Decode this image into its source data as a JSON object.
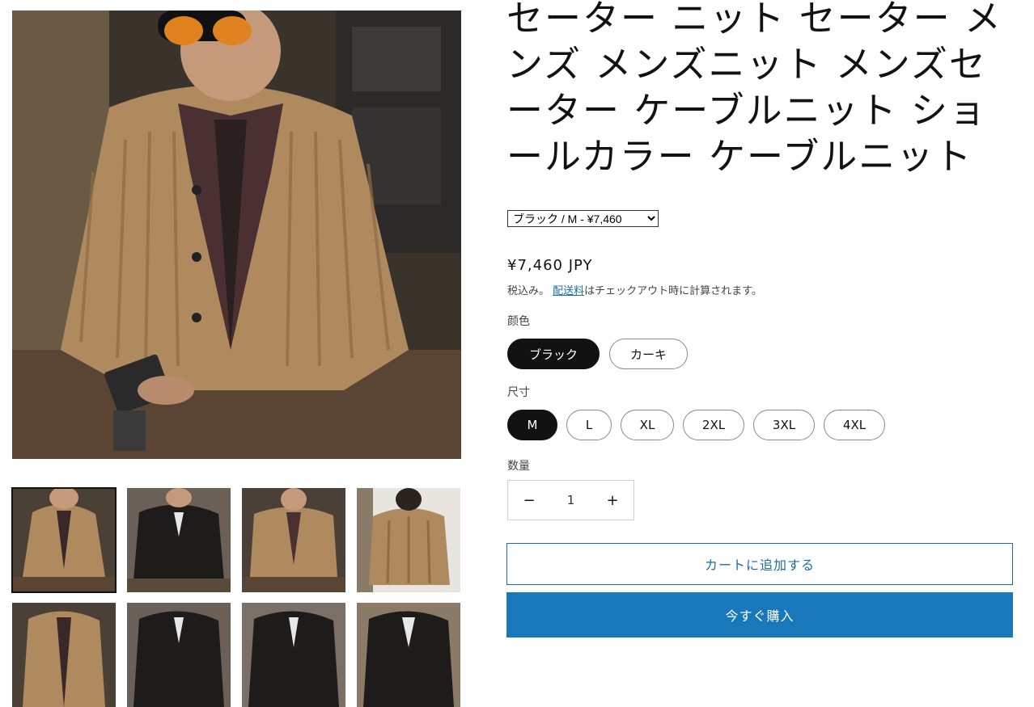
{
  "product": {
    "title": "セーター ニット セーター メンズ メンズニット メンズセーター ケーブルニット ショールカラー ケーブルニット",
    "variant_select": "ブラック / M - ¥7,460",
    "price": "¥7,460 JPY",
    "tax_prefix": "税込み。",
    "shipping_link": "配送料",
    "tax_suffix": "はチェックアウト時に計算されます。"
  },
  "options": {
    "color_label": "颜色",
    "colors": [
      "ブラック",
      "カーキ"
    ],
    "selected_color": "ブラック",
    "size_label": "尺寸",
    "sizes": [
      "M",
      "L",
      "XL",
      "2XL",
      "3XL",
      "4XL"
    ],
    "selected_size": "M"
  },
  "quantity": {
    "label": "数量",
    "value": "1",
    "minus": "−",
    "plus": "+"
  },
  "actions": {
    "add_to_cart": "カートに追加する",
    "buy_now": "今すぐ購入"
  },
  "colors": {
    "accent": "#1878b9",
    "dark": "#121212",
    "knit_khaki": "#b08a5f",
    "knit_black": "#1d1c1b"
  }
}
